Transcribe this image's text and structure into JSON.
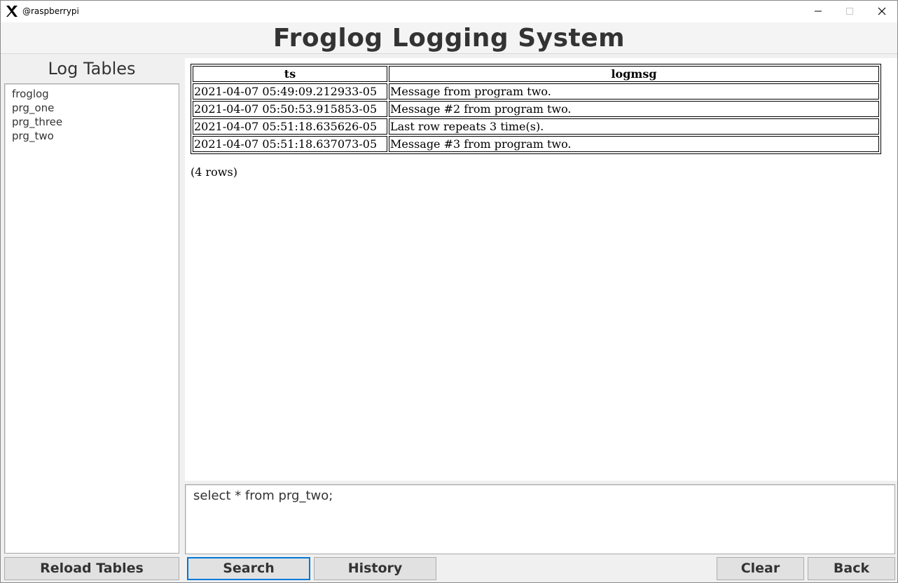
{
  "window": {
    "title": "@raspberrypi",
    "icon": "x-server-icon",
    "controls": [
      "minimize-icon",
      "maximize-icon",
      "close-icon"
    ]
  },
  "header": {
    "title": "Froglog Logging System"
  },
  "sidebar": {
    "title": "Log Tables",
    "items": [
      {
        "label": "froglog"
      },
      {
        "label": "prg_one"
      },
      {
        "label": "prg_three"
      },
      {
        "label": "prg_two"
      }
    ]
  },
  "results": {
    "columns": [
      "ts",
      "logmsg"
    ],
    "rows": [
      [
        "2021-04-07 05:49:09.212933-05",
        "Message from program two."
      ],
      [
        "2021-04-07 05:50:53.915853-05",
        "Message #2 from program two."
      ],
      [
        "2021-04-07 05:51:18.635626-05",
        "Last row repeats 3 time(s)."
      ],
      [
        "2021-04-07 05:51:18.637073-05",
        "Message #3 from program two."
      ]
    ],
    "row_count": "(4 rows)"
  },
  "query": {
    "value": "select * from prg_two;"
  },
  "buttons": {
    "reload": "Reload Tables",
    "search": "Search",
    "history": "History",
    "clear": "Clear",
    "back": "Back"
  },
  "colors": {
    "focus_border": "#0078d7",
    "button_bg": "#e1e1e1",
    "text": "#333333"
  }
}
